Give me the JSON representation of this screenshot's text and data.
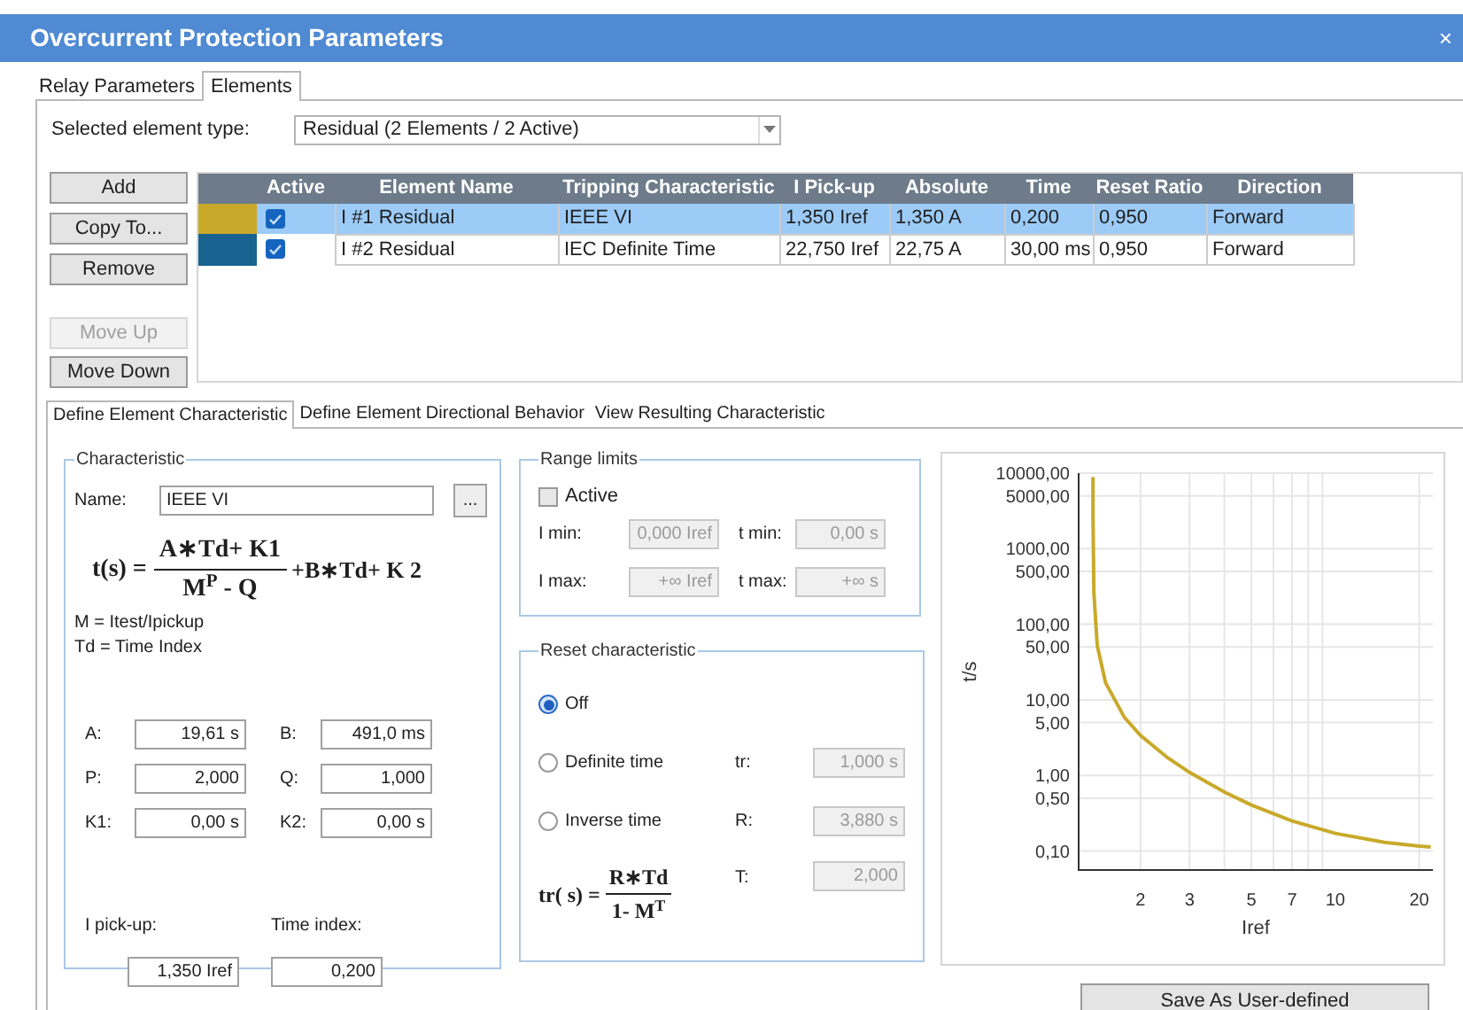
{
  "window": {
    "title": "Overcurrent Protection Parameters",
    "close": "×"
  },
  "tabs": [
    {
      "label": "Relay Parameters",
      "selected": false
    },
    {
      "label": "Elements",
      "selected": true
    }
  ],
  "element_type": {
    "label": "Selected element type:",
    "value": "Residual (2 Elements / 2 Active)"
  },
  "buttons": [
    {
      "label": "Add",
      "disabled": false
    },
    {
      "label": "Copy To...",
      "disabled": false
    },
    {
      "label": "Remove",
      "disabled": false
    },
    {
      "label": "Move Up",
      "disabled": true
    },
    {
      "label": "Move Down",
      "disabled": false
    }
  ],
  "table": {
    "active_column": "Active",
    "columns": [
      "Element Name",
      "Tripping Characteristic",
      "I Pick-up",
      "Absolute",
      "Time",
      "Reset Ratio",
      "Direction"
    ],
    "rows": [
      {
        "color": "#c9a92a",
        "active": true,
        "selected": true,
        "cells": [
          "I #1 Residual",
          "IEEE VI",
          "1,350 Iref",
          "1,350 A",
          "0,200",
          "0,950",
          "Forward"
        ]
      },
      {
        "color": "#17628f",
        "active": true,
        "selected": false,
        "cells": [
          "I #2 Residual",
          "IEC Definite Time",
          "22,750 Iref",
          "22,75 A",
          "30,00 ms",
          "0,950",
          "Forward"
        ]
      }
    ]
  },
  "sub_tabs": [
    {
      "label": "Define Element Characteristic",
      "selected": true
    },
    {
      "label": "Define Element Directional Behavior",
      "selected": false
    },
    {
      "label": "View Resulting Characteristic",
      "selected": false
    }
  ],
  "characteristic": {
    "title": "Characteristic",
    "name_label": "Name:",
    "name_value": "IEEE VI",
    "browse": "...",
    "formula": {
      "lhs": "t(s) =",
      "numerator": "A∗Td+ K1",
      "denominator": "M$^{P}$ - Q",
      "tail": "+B∗Td+ K 2"
    },
    "legend": [
      "M = Itest/Ipickup",
      "Td = Time Index"
    ],
    "parameters": [
      {
        "label": "A:",
        "value": "19,61 s"
      },
      {
        "label": "B:",
        "value": "491,0 ms"
      },
      {
        "label": "P:",
        "value": "2,000"
      },
      {
        "label": "Q:",
        "value": "1,000"
      },
      {
        "label": "K1:",
        "value": "0,00 s"
      },
      {
        "label": "K2:",
        "value": "0,00 s"
      }
    ],
    "pickup": {
      "label": "I pick-up:",
      "value": "1,350 Iref"
    },
    "time_index": {
      "label": "Time index:",
      "value": "0,200"
    }
  },
  "range_limits": {
    "title": "Range limits",
    "active": {
      "label": "Active",
      "checked": false
    },
    "fields": [
      {
        "label": "I min:",
        "value": "0,000 Iref",
        "disabled": true
      },
      {
        "label": "t min:",
        "value": "0,00 s",
        "disabled": true
      },
      {
        "label": "I max:",
        "value": "+∞ Iref",
        "disabled": true
      },
      {
        "label": "t max:",
        "value": "+∞ s",
        "disabled": true
      }
    ]
  },
  "reset": {
    "title": "Reset characteristic",
    "options": [
      {
        "label": "Off",
        "selected": true
      },
      {
        "label": "Definite time",
        "selected": false
      },
      {
        "label": "Inverse time",
        "selected": false
      }
    ],
    "fields": [
      {
        "label": "tr:",
        "value": "1,000 s",
        "disabled": true
      },
      {
        "label": "R:",
        "value": "3,880 s",
        "disabled": true
      },
      {
        "label": "T:",
        "value": "2,000",
        "disabled": true
      }
    ],
    "formula": {
      "lhs": "tr( s) =",
      "numerator": "R∗Td",
      "denominator": "1- M$^{T}$"
    }
  },
  "chart": {
    "xlabel": "Iref",
    "ylabel": "t/s",
    "xtick_labels": [
      "2",
      "3",
      "5",
      "7",
      "10",
      "20"
    ],
    "ytick_labels": [
      "10000,00",
      "5000,00",
      "1000,00",
      "500,00",
      "100,00",
      "50,00",
      "10,00",
      "5,00",
      "1,00",
      "0,50",
      "0,10"
    ]
  },
  "save_button": "Save As User-defined"
}
